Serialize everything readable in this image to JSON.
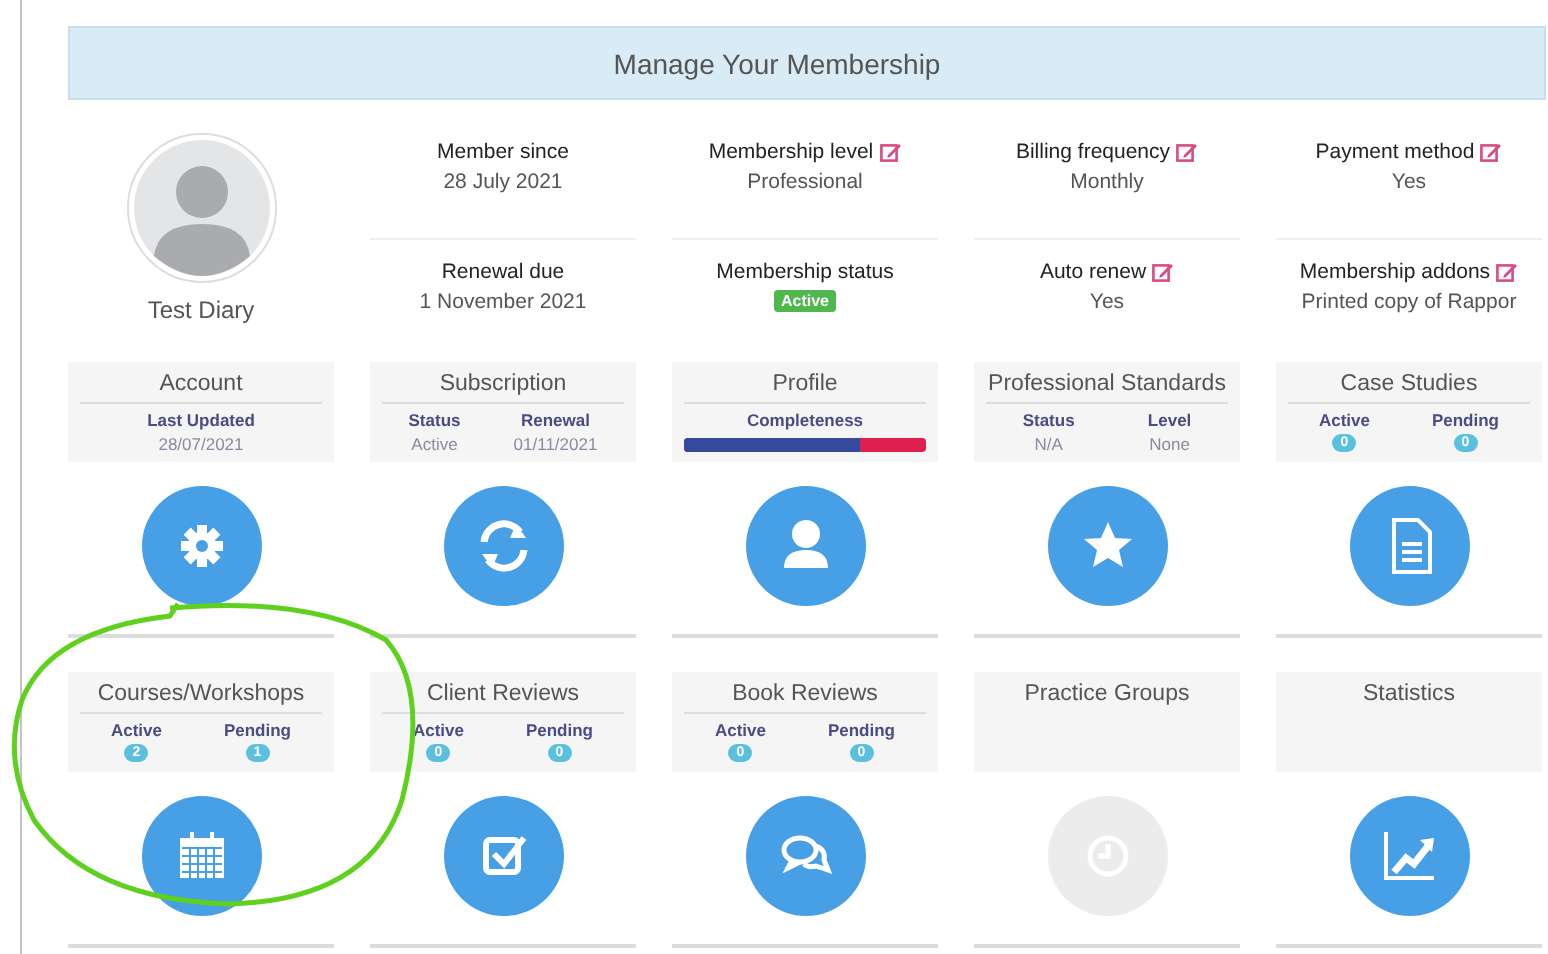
{
  "header": {
    "title": "Manage Your Membership"
  },
  "profile": {
    "name": "Test Diary"
  },
  "details": [
    {
      "label": "Member since",
      "value": "28 July 2021",
      "kind": "text",
      "editable": false
    },
    {
      "label": "Membership level",
      "value": "Professional",
      "kind": "text",
      "editable": true
    },
    {
      "label": "Billing frequency",
      "value": "Monthly",
      "kind": "text",
      "editable": true
    },
    {
      "label": "Payment method",
      "value": "Yes",
      "kind": "text",
      "editable": true
    },
    {
      "label": "Renewal due",
      "value": "1 November 2021",
      "kind": "text",
      "editable": false
    },
    {
      "label": "Membership status",
      "value": "Active",
      "kind": "badge",
      "editable": false
    },
    {
      "label": "Auto renew",
      "value": "Yes",
      "kind": "text",
      "editable": true
    },
    {
      "label": "Membership addons",
      "value": "Printed copy of Rappor",
      "kind": "text",
      "editable": true
    }
  ],
  "cards": [
    {
      "title": "Account",
      "kind": "stats",
      "enabled": true,
      "stats": [
        {
          "label": "Last Updated",
          "value": "28/07/2021",
          "kind": "text"
        }
      ]
    },
    {
      "title": "Subscription",
      "kind": "stats",
      "enabled": true,
      "stats": [
        {
          "label": "Status",
          "value": "Active",
          "kind": "text"
        },
        {
          "label": "Renewal",
          "value": "01/11/2021",
          "kind": "text"
        }
      ]
    },
    {
      "title": "Profile",
      "kind": "progress",
      "enabled": true,
      "progress_label": "Completeness",
      "level": 0.73
    },
    {
      "title": "Professional Standards",
      "kind": "stats",
      "enabled": true,
      "stats": [
        {
          "label": "Status",
          "value": "N/A",
          "kind": "text"
        },
        {
          "label": "Level",
          "value": "None",
          "kind": "text"
        }
      ]
    },
    {
      "title": "Case Studies",
      "kind": "stats",
      "enabled": true,
      "stats": [
        {
          "label": "Active",
          "value": "0",
          "kind": "badge"
        },
        {
          "label": "Pending",
          "value": "0",
          "kind": "badge"
        }
      ]
    },
    {
      "title": "Courses/Workshops",
      "kind": "stats",
      "enabled": true,
      "stats": [
        {
          "label": "Active",
          "value": "2",
          "kind": "badge"
        },
        {
          "label": "Pending",
          "value": "1",
          "kind": "badge"
        }
      ]
    },
    {
      "title": "Client Reviews",
      "kind": "stats",
      "enabled": true,
      "stats": [
        {
          "label": "Active",
          "value": "0",
          "kind": "badge"
        },
        {
          "label": "Pending",
          "value": "0",
          "kind": "badge"
        }
      ]
    },
    {
      "title": "Book Reviews",
      "kind": "stats",
      "enabled": true,
      "stats": [
        {
          "label": "Active",
          "value": "0",
          "kind": "badge"
        },
        {
          "label": "Pending",
          "value": "0",
          "kind": "badge"
        }
      ]
    },
    {
      "title": "Practice Groups",
      "kind": "plain",
      "enabled": false
    },
    {
      "title": "Statistics",
      "kind": "plain",
      "enabled": true
    }
  ],
  "annotation": {
    "kind": "freehand-circle"
  }
}
